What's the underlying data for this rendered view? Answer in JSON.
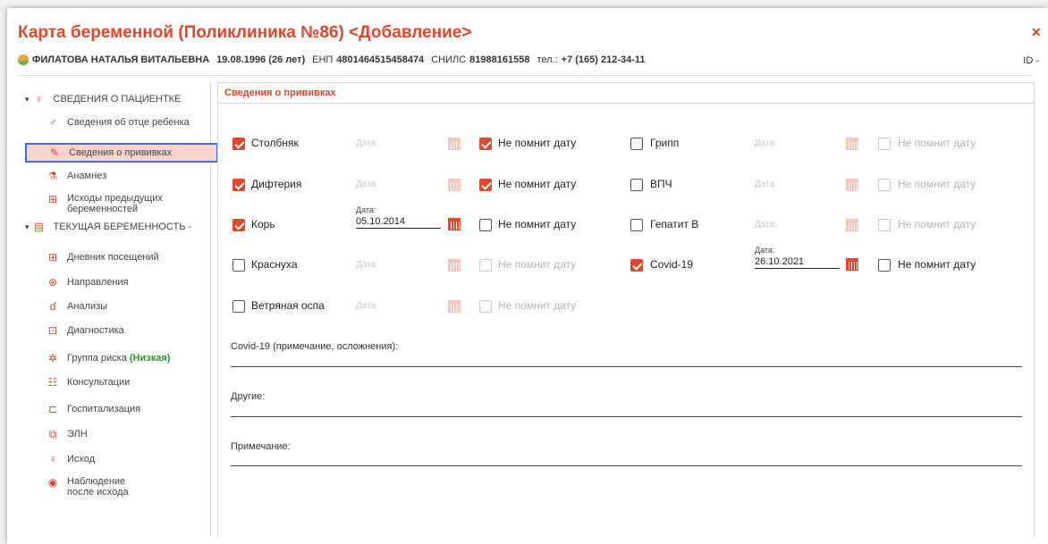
{
  "window": {
    "title": "Карта беременной (Поликлиника №86) <Добавление>",
    "close_glyph": "×"
  },
  "patient": {
    "name": "ФИЛАТОВА НАТАЛЬЯ ВИТАЛЬЕВНА",
    "birth": "19.08.1996 (26 лет)",
    "enp_label": "ЕНП",
    "enp": "4801464515458474",
    "snils_label": "СНИЛС",
    "snils": "81988161558",
    "phone_label": "тел.:",
    "phone": "+7 (165) 212-34-11",
    "id_label": "ID -"
  },
  "sidebar": {
    "section1": "СВЕДЕНИЯ О ПАЦИЕНТКЕ",
    "father": "Сведения об отце ребенка",
    "vaccinations": "Сведения о прививках",
    "anamnesis": "Анамнез",
    "prev_outcomes": "Исходы предыдущих беременностей",
    "section2": "ТЕКУЩАЯ БЕРЕМЕННОСТЬ -",
    "diary": "Дневник посещений",
    "referrals": "Направления",
    "analyses": "Анализы",
    "diagnostics": "Диагностика",
    "risk_group": "Группа риска",
    "risk_value": "(Низкая)",
    "consultations": "Консультации",
    "hospitalization": "Госпитализация",
    "eln": "ЭЛН",
    "outcome": "Исход",
    "observation": "Наблюдение после исхода"
  },
  "main": {
    "header": "Сведения о прививках",
    "date_placeholder": "Дата:",
    "date_caption": "Дата:",
    "dont_remember": "Не помнит дату",
    "vaccines": {
      "tetanus": {
        "label": "Столбняк",
        "checked": true,
        "date": "",
        "dont_remember": true
      },
      "diphtheria": {
        "label": "Дифтерия",
        "checked": true,
        "date": "",
        "dont_remember": true
      },
      "measles": {
        "label": "Корь",
        "checked": true,
        "date": "05.10.2014",
        "dont_remember": false
      },
      "rubella": {
        "label": "Краснуха",
        "checked": false,
        "date": "",
        "dont_remember": false
      },
      "chickenpox": {
        "label": "Ветряная оспа",
        "checked": false,
        "date": "",
        "dont_remember": false
      },
      "flu": {
        "label": "Грипп",
        "checked": false,
        "date": "",
        "dont_remember": false
      },
      "hpv": {
        "label": "ВПЧ",
        "checked": false,
        "date": "",
        "dont_remember": false
      },
      "hepb": {
        "label": "Гепатит В",
        "checked": false,
        "date": "",
        "dont_remember": false
      },
      "covid": {
        "label": "Covid-19",
        "checked": true,
        "date": "26.10.2021",
        "dont_remember": false
      }
    },
    "covid_note_label": "Covid-19 (примечание, осложнения):",
    "other_label": "Другие:",
    "note_label": "Примечание:"
  },
  "colors": {
    "accent": "#e0472b",
    "selection_border": "#3c6fdc",
    "risk_low": "#2a9a2a"
  }
}
